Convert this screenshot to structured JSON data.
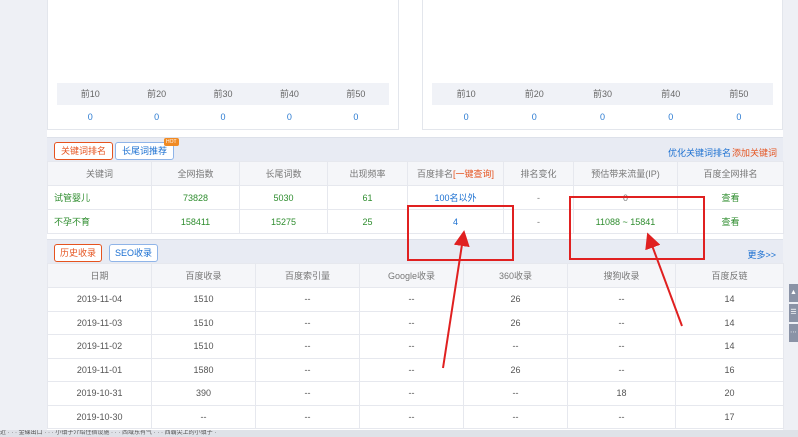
{
  "rank_panels": {
    "labels": [
      "前10",
      "前20",
      "前30",
      "前40",
      "前50"
    ],
    "left_values": [
      "0",
      "0",
      "0",
      "0",
      "0"
    ],
    "right_values": [
      "0",
      "0",
      "0",
      "0",
      "0"
    ]
  },
  "keyword_section": {
    "tab_active": "关键词排名",
    "tab_other": "长尾词推荐",
    "hot_badge": "HOT",
    "link_optimize": "优化关键词排名",
    "link_add": "添加关键词",
    "headers": [
      "关键词",
      "全网指数",
      "长尾词数",
      "出现频率",
      "百度排名",
      "排名变化",
      "预估带来流量(IP)",
      "百度全网排名"
    ],
    "query_link": "[一键查询]",
    "rows": [
      {
        "keyword": "试管婴儿",
        "index": "73828",
        "longtail": "5030",
        "freq": "61",
        "rank": "100名以外",
        "change": "-",
        "traffic": "0",
        "action": "查看"
      },
      {
        "keyword": "不孕不育",
        "index": "158411",
        "longtail": "15275",
        "freq": "25",
        "rank": "4",
        "change": "-",
        "traffic": "11088 ~ 15841",
        "action": "查看"
      }
    ]
  },
  "history_section": {
    "tab_active": "历史收录",
    "tab_other": "SEO收录",
    "more_link": "更多>>",
    "headers": [
      "日期",
      "百度收录",
      "百度索引量",
      "Google收录",
      "360收录",
      "搜狗收录",
      "百度反链"
    ],
    "rows": [
      [
        "2019-11-04",
        "1510",
        "--",
        "--",
        "26",
        "--",
        "14"
      ],
      [
        "2019-11-03",
        "1510",
        "--",
        "--",
        "26",
        "--",
        "14"
      ],
      [
        "2019-11-02",
        "1510",
        "--",
        "--",
        "--",
        "--",
        "14"
      ],
      [
        "2019-11-01",
        "1580",
        "--",
        "--",
        "26",
        "--",
        "16"
      ],
      [
        "2019-10-31",
        "390",
        "--",
        "--",
        "--",
        "18",
        "20"
      ],
      [
        "2019-10-30",
        "--",
        "--",
        "--",
        "--",
        "--",
        "17"
      ]
    ]
  },
  "status_bar": {
    "text": "近 · · · 金碟出口 · · · 小镇子介绍住宿设施 · · · 西域东有气 · · · 西霸尖上的小镇子 ·"
  },
  "colors": {
    "accent_red": "#e5531f",
    "link_blue": "#1a6fd1",
    "keyword_green": "#2f8d2f",
    "annotation_red": "#e02020"
  }
}
